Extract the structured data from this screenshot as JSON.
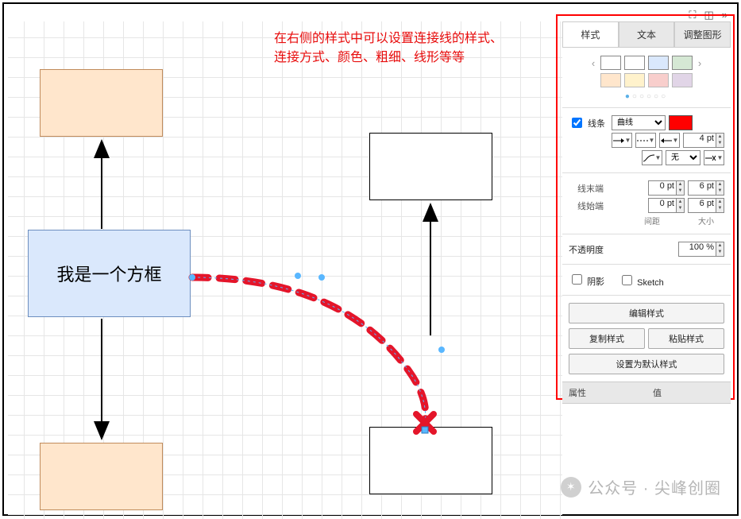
{
  "annotation": {
    "line1": "在右侧的样式中可以设置连接线的样式、",
    "line2": "连接方式、颜色、粗细、线形等等"
  },
  "canvas": {
    "box_label": "我是一个方框"
  },
  "toolbar_icons": {
    "fullscreen": "⛶",
    "panels": "◫",
    "collapse": "»"
  },
  "panel": {
    "tabs": {
      "style": "样式",
      "text": "文本",
      "arrange": "调整图形"
    },
    "swatches": {
      "row1": [
        "#ffffff",
        "#ffffff",
        "#dae8fc",
        "#d5e8d4"
      ],
      "row2": [
        "#ffe6cc",
        "#fff2cc",
        "#f8cecc",
        "#e1d5e7"
      ]
    },
    "line": {
      "checkbox_label": "线条",
      "checked": true,
      "type_select": "曲线",
      "color": "#ff0000",
      "width_value": "4 pt",
      "waypoint_select": "无"
    },
    "ends": {
      "label_end": "线末端",
      "label_start": "线始端",
      "end_gap": "0 pt",
      "end_size": "6 pt",
      "start_gap": "0 pt",
      "start_size": "6 pt",
      "col_gap": "间距",
      "col_size": "大小"
    },
    "opacity": {
      "label": "不透明度",
      "value": "100 %"
    },
    "effects": {
      "shadow": "阴影",
      "sketch": "Sketch"
    },
    "buttons": {
      "edit": "编辑样式",
      "copy": "复制样式",
      "paste": "粘贴样式",
      "default": "设置为默认样式"
    },
    "properties": {
      "attr": "属性",
      "val": "值"
    }
  },
  "watermark": "公众号 · 尖峰创圈"
}
